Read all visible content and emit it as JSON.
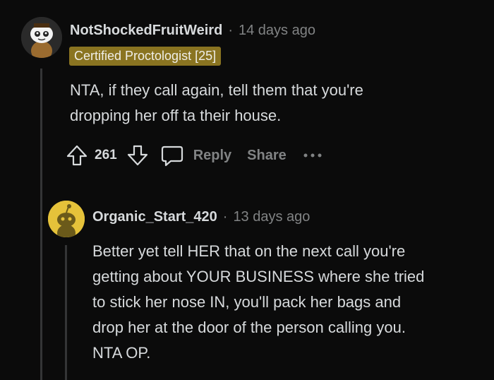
{
  "comment1": {
    "username": "NotShockedFruitWeird",
    "separator": "·",
    "time": "14 days ago",
    "flair": "Certified Proctologist [25]",
    "body_lines": [
      "NTA, if they call again, tell them that you're",
      "dropping her off ta their house."
    ],
    "score": "261",
    "reply_label": "Reply",
    "share_label": "Share"
  },
  "comment2": {
    "username": "Organic_Start_420",
    "separator": "·",
    "time": "13 days ago",
    "body_lines": [
      "Better yet tell HER that on the next call you're",
      "getting about YOUR BUSINESS where she tried",
      "to stick her nose IN, you'll pack her bags and",
      "drop her at the door of the person calling you.",
      "NTA OP."
    ]
  },
  "colors": {
    "background": "#0b0b0b",
    "text": "#d7dadc",
    "muted": "#818384",
    "flair_bg": "#8a7421",
    "avatar2_bg": "#e5c23a"
  },
  "icons": {
    "upvote": "arrow-up-icon",
    "downvote": "arrow-down-icon",
    "reply": "speech-bubble-icon",
    "more": "ellipsis-icon"
  }
}
